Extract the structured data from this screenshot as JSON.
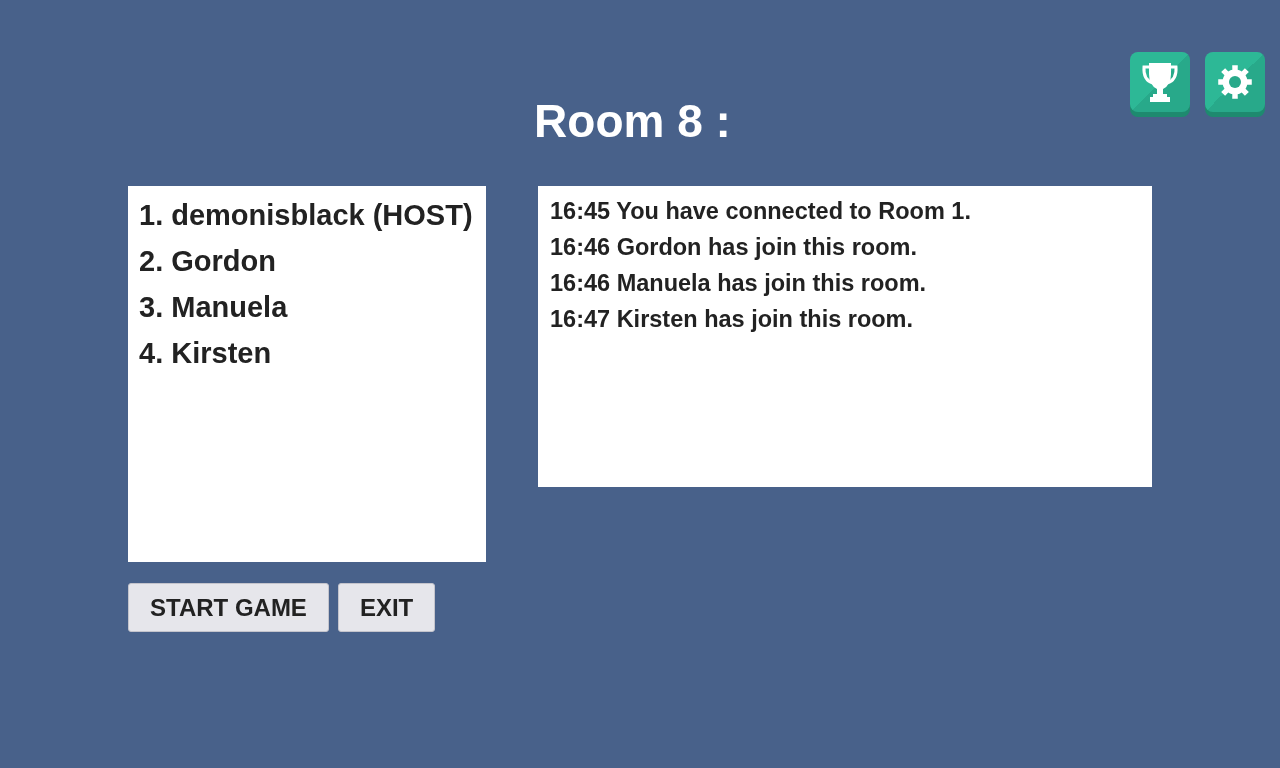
{
  "title": "Room 8 :",
  "players": [
    "1. demonisblack (HOST)",
    "2. Gordon",
    "3. Manuela",
    "4. Kirsten"
  ],
  "chat_log": [
    "16:45 You have connected to Room 1.",
    "16:46 Gordon has join this room.",
    "16:46 Manuela has join this room.",
    "16:47 Kirsten has join this room."
  ],
  "buttons": [
    "START GAME",
    "EXIT"
  ]
}
